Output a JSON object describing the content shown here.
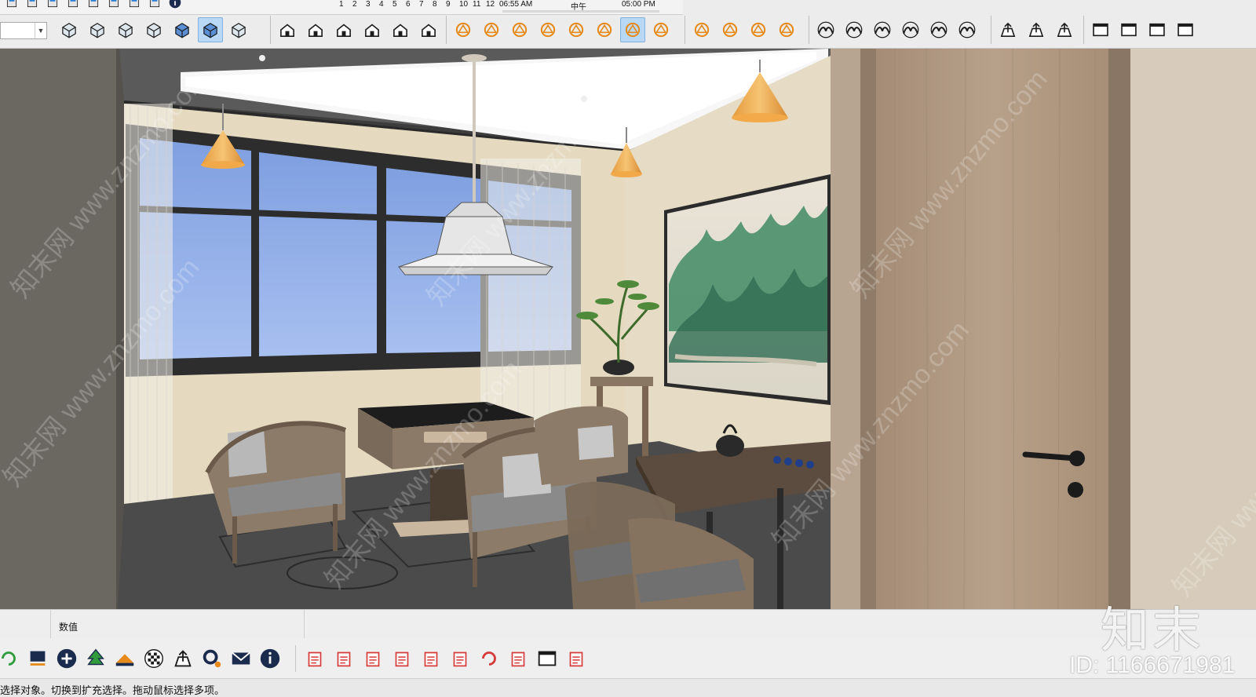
{
  "toolbar": {
    "scene_numbers": [
      "1",
      "2",
      "3",
      "4",
      "5",
      "6",
      "7",
      "8",
      "9",
      "10",
      "11",
      "12"
    ],
    "time_start": "06:55 AM",
    "time_mid": "中午",
    "time_end": "05:00 PM",
    "active_color": "#b9d8f5",
    "groups": {
      "file": [
        "save-icon",
        "scissors-icon",
        "copy-icon",
        "paste-icon",
        "erase-icon",
        "undo-icon",
        "redo-icon",
        "print-icon",
        "model-info-icon"
      ],
      "styles": [
        "xray-icon",
        "back-edges-icon",
        "wireframe-icon",
        "hidden-line-icon",
        "shaded-icon",
        "shaded-textures-icon",
        "monochrome-icon"
      ],
      "views": [
        "iso-view-icon",
        "top-view-icon",
        "front-view-icon",
        "right-view-icon",
        "back-view-icon",
        "left-view-icon"
      ],
      "solids": [
        "solid-outer-shell-icon",
        "solid-intersect-icon",
        "solid-union-icon",
        "solid-subtract-icon",
        "solid-trim-icon",
        "solid-split-icon",
        "solid-tools-icon",
        "solid-extra-icon"
      ],
      "sections": [
        "position-camera-icon",
        "section-plane-icon",
        "section-cuts-icon",
        "section-fill-icon"
      ],
      "sandbox": [
        "sandbox-from-contours-icon",
        "sandbox-from-scratch-icon",
        "sandbox-smoove-icon",
        "sandbox-stamp-icon",
        "sandbox-drape-icon",
        "sandbox-add-detail-icon"
      ],
      "warehouse": [
        "warehouse-icon",
        "upload-icon",
        "extension-warehouse-icon"
      ],
      "window": [
        "window-icon",
        "layout-icon",
        "export-icon",
        "lock-icon"
      ]
    },
    "active_style": "shaded-textures-icon",
    "active_solid": "solid-tools-icon"
  },
  "viewport": {
    "watermark_text": "知末网 www.znzmo.com"
  },
  "measurements": {
    "label": "数值",
    "value": ""
  },
  "bottom_toolbar": {
    "group_a": [
      "refresh-icon",
      "swap-icon",
      "add-icon",
      "tree-icon",
      "layers-icon",
      "checker-icon",
      "cloud-upload-icon",
      "settings-icon",
      "mail-icon",
      "info-icon"
    ],
    "group_b": [
      "ruby-icon",
      "sketchup-icon",
      "paint-icon",
      "palette-icon",
      "light-icon",
      "import-icon",
      "pm-refresh-icon",
      "document-icon",
      "document-export-icon",
      "expand-icon"
    ]
  },
  "status": {
    "text": "选择对象。切换到扩充选择。拖动鼠标选择多项。"
  },
  "watermark": {
    "logo": "知末",
    "id": "ID: 1166671981"
  }
}
